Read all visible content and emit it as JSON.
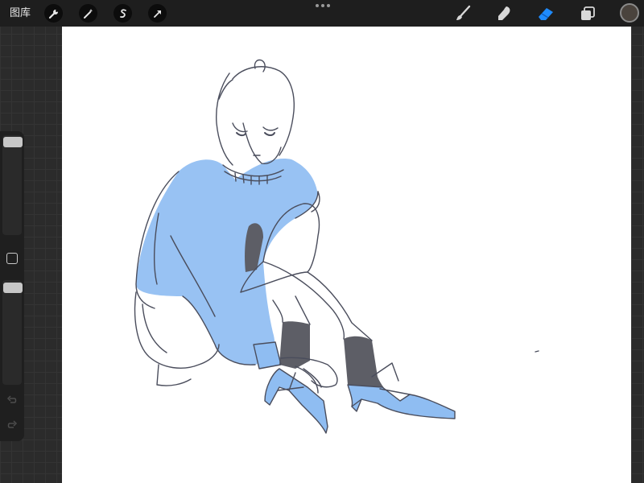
{
  "topbar": {
    "gallery_label": "图库",
    "tools_left": [
      "wrench-icon",
      "magic-wand-icon",
      "selection-icon",
      "transform-arrow-icon"
    ],
    "tools_right": [
      "brush-icon",
      "smudge-icon",
      "eraser-icon",
      "layers-icon"
    ],
    "active_tool": "eraser-icon",
    "active_color": "#4a433d",
    "accent_color": "#1e8bff"
  },
  "sidebar": {
    "brush_size_level": 0.0,
    "opacity_level": 0.0,
    "undo_icon": "undo-icon",
    "redo_icon": "redo-icon"
  },
  "canvas": {
    "background": "#ffffff",
    "sketch_colors": {
      "line": "#4a4d5c",
      "fill": "#8fbdf2",
      "sock": "#5d5e66"
    }
  }
}
